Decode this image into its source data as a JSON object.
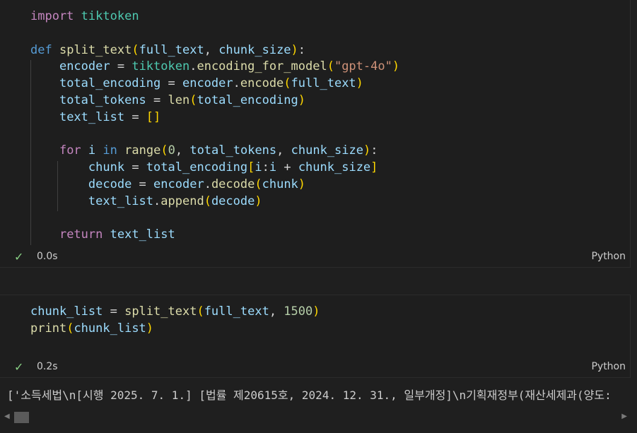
{
  "cells": [
    {
      "lines": [
        [
          [
            "kw-import",
            "import"
          ],
          [
            "op",
            " "
          ],
          [
            "mod",
            "tiktoken"
          ]
        ],
        [],
        [
          [
            "kw",
            "def"
          ],
          [
            "op",
            " "
          ],
          [
            "fn",
            "split_text"
          ],
          [
            "b1",
            "("
          ],
          [
            "var",
            "full_text"
          ],
          [
            "op",
            ", "
          ],
          [
            "var",
            "chunk_size"
          ],
          [
            "b1",
            ")"
          ],
          [
            "op",
            ":"
          ]
        ],
        [
          [
            "op",
            "    "
          ],
          [
            "var",
            "encoder"
          ],
          [
            "op",
            " = "
          ],
          [
            "mod",
            "tiktoken"
          ],
          [
            "op",
            "."
          ],
          [
            "fn",
            "encoding_for_model"
          ],
          [
            "b1",
            "("
          ],
          [
            "str",
            "\"gpt-4o\""
          ],
          [
            "b1",
            ")"
          ]
        ],
        [
          [
            "op",
            "    "
          ],
          [
            "var",
            "total_encoding"
          ],
          [
            "op",
            " = "
          ],
          [
            "var",
            "encoder"
          ],
          [
            "op",
            "."
          ],
          [
            "fn",
            "encode"
          ],
          [
            "b1",
            "("
          ],
          [
            "var",
            "full_text"
          ],
          [
            "b1",
            ")"
          ]
        ],
        [
          [
            "op",
            "    "
          ],
          [
            "var",
            "total_tokens"
          ],
          [
            "op",
            " = "
          ],
          [
            "fn",
            "len"
          ],
          [
            "b1",
            "("
          ],
          [
            "var",
            "total_encoding"
          ],
          [
            "b1",
            ")"
          ]
        ],
        [
          [
            "op",
            "    "
          ],
          [
            "var",
            "text_list"
          ],
          [
            "op",
            " = "
          ],
          [
            "b1",
            "[]"
          ]
        ],
        [],
        [
          [
            "op",
            "    "
          ],
          [
            "kw-ctrl",
            "for"
          ],
          [
            "op",
            " "
          ],
          [
            "var",
            "i"
          ],
          [
            "op",
            " "
          ],
          [
            "kw",
            "in"
          ],
          [
            "op",
            " "
          ],
          [
            "fn",
            "range"
          ],
          [
            "b1",
            "("
          ],
          [
            "num",
            "0"
          ],
          [
            "op",
            ", "
          ],
          [
            "var",
            "total_tokens"
          ],
          [
            "op",
            ", "
          ],
          [
            "var",
            "chunk_size"
          ],
          [
            "b1",
            ")"
          ],
          [
            "op",
            ":"
          ]
        ],
        [
          [
            "op",
            "        "
          ],
          [
            "var",
            "chunk"
          ],
          [
            "op",
            " = "
          ],
          [
            "var",
            "total_encoding"
          ],
          [
            "b1",
            "["
          ],
          [
            "var",
            "i"
          ],
          [
            "op",
            ":"
          ],
          [
            "var",
            "i"
          ],
          [
            "op",
            " + "
          ],
          [
            "var",
            "chunk_size"
          ],
          [
            "b1",
            "]"
          ]
        ],
        [
          [
            "op",
            "        "
          ],
          [
            "var",
            "decode"
          ],
          [
            "op",
            " = "
          ],
          [
            "var",
            "encoder"
          ],
          [
            "op",
            "."
          ],
          [
            "fn",
            "decode"
          ],
          [
            "b1",
            "("
          ],
          [
            "var",
            "chunk"
          ],
          [
            "b1",
            ")"
          ]
        ],
        [
          [
            "op",
            "        "
          ],
          [
            "var",
            "text_list"
          ],
          [
            "op",
            "."
          ],
          [
            "fn",
            "append"
          ],
          [
            "b1",
            "("
          ],
          [
            "var",
            "decode"
          ],
          [
            "b1",
            ")"
          ]
        ],
        [],
        [
          [
            "op",
            "    "
          ],
          [
            "kw-ctrl",
            "return"
          ],
          [
            "op",
            " "
          ],
          [
            "var",
            "text_list"
          ]
        ]
      ],
      "check_icon": "check-icon",
      "time": "0.0s",
      "language": "Python"
    },
    {
      "lines": [
        [
          [
            "var",
            "chunk_list"
          ],
          [
            "op",
            " = "
          ],
          [
            "fn",
            "split_text"
          ],
          [
            "b1",
            "("
          ],
          [
            "var",
            "full_text"
          ],
          [
            "op",
            ", "
          ],
          [
            "num",
            "1500"
          ],
          [
            "b1",
            ")"
          ]
        ],
        [
          [
            "fn",
            "print"
          ],
          [
            "b1",
            "("
          ],
          [
            "var",
            "chunk_list"
          ],
          [
            "b1",
            ")"
          ]
        ]
      ],
      "check_icon": "check-icon",
      "time": "0.2s",
      "language": "Python"
    }
  ],
  "output_text": "['소득세법\\n[시행 2025. 7. 1.] [법률 제20615호, 2024. 12. 31., 일부개정]\\n기획재정부(재산세제과(양도:",
  "colors": {
    "background": "#1f1f1f",
    "keyword_import": "#c586c0",
    "keyword": "#569cd6",
    "function": "#dcdcaa",
    "variable": "#9cdcfe",
    "module": "#4ec9b0",
    "string": "#ce9178",
    "number": "#b5cea8",
    "bracket": "#ffd700",
    "success": "#89d185"
  }
}
